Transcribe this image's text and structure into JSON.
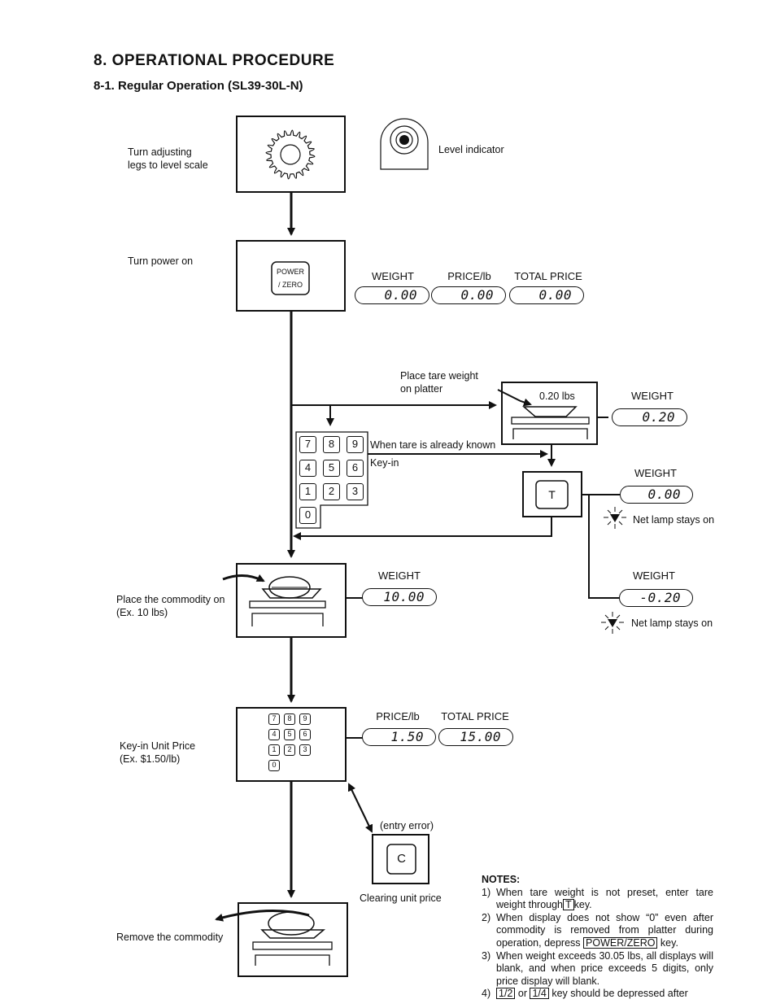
{
  "header": {
    "title": "8. OPERATIONAL PROCEDURE",
    "subtitle": "8-1. Regular Operation (SL39-30L-N)"
  },
  "steps": {
    "level": {
      "label_line1": "Turn adjusting",
      "label_line2": "legs to level scale",
      "indicator_label": "Level indicator"
    },
    "power": {
      "label": "Turn power on",
      "key_line1": "POWER",
      "key_line2": "/ ZERO",
      "displays": [
        {
          "label": "WEIGHT",
          "value": "0.00"
        },
        {
          "label": "PRICE/lb",
          "value": "0.00"
        },
        {
          "label": "TOTAL PRICE",
          "value": "0.00"
        }
      ]
    },
    "tare": {
      "place_label_line1": "Place tare weight",
      "place_label_line2": "on platter",
      "tare_weight": "0.20 lbs",
      "weight_label": "WEIGHT",
      "weight_value": "0.20",
      "known_label": "When tare is already known",
      "keyin_label": "Key-in",
      "keypad": [
        "7",
        "8",
        "9",
        "4",
        "5",
        "6",
        "1",
        "2",
        "3",
        "0"
      ],
      "t_key": "T",
      "after_t_label": "WEIGHT",
      "after_t_value": "0.00",
      "net_lamp_1": "Net lamp stays on",
      "removed_label": "WEIGHT",
      "removed_value": "-0.20",
      "net_lamp_2": "Net lamp stays on"
    },
    "commodity": {
      "label_line1": "Place the commodity on",
      "label_line2": "(Ex. 10 lbs)",
      "weight_label": "WEIGHT",
      "weight_value": "10.00"
    },
    "unit_price": {
      "label_line1": "Key-in Unit Price",
      "label_line2": "(Ex. $1.50/lb)",
      "keypad": [
        "7",
        "8",
        "9",
        "4",
        "5",
        "6",
        "1",
        "2",
        "3",
        "0"
      ],
      "price_label": "PRICE/lb",
      "price_value": "1.50",
      "total_label": "TOTAL PRICE",
      "total_value": "15.00"
    },
    "clear": {
      "error_label": "(entry error)",
      "c_key": "C",
      "label": "Clearing unit price"
    },
    "remove": {
      "label": "Remove the commodity"
    }
  },
  "notes": {
    "title": "NOTES:",
    "items": [
      {
        "num": "1)",
        "pre": "When tare weight is not preset, enter tare weight through",
        "key": "T",
        "post": "key."
      },
      {
        "num": "2)",
        "pre": "When display does not show “0” even after commodity is removed from platter during operation, depress",
        "key": "POWER/ZERO",
        "post": " key."
      },
      {
        "num": "3)",
        "pre": "When weight exceeds 30.05 lbs, all displays will blank, and when price exceeds 5 digits, only price display will blank.",
        "key": "",
        "post": ""
      },
      {
        "num": "4)",
        "pre": "",
        "key": "1/2",
        "mid": " or ",
        "key2": "1/4",
        "post": " key should be depressed after"
      }
    ]
  }
}
